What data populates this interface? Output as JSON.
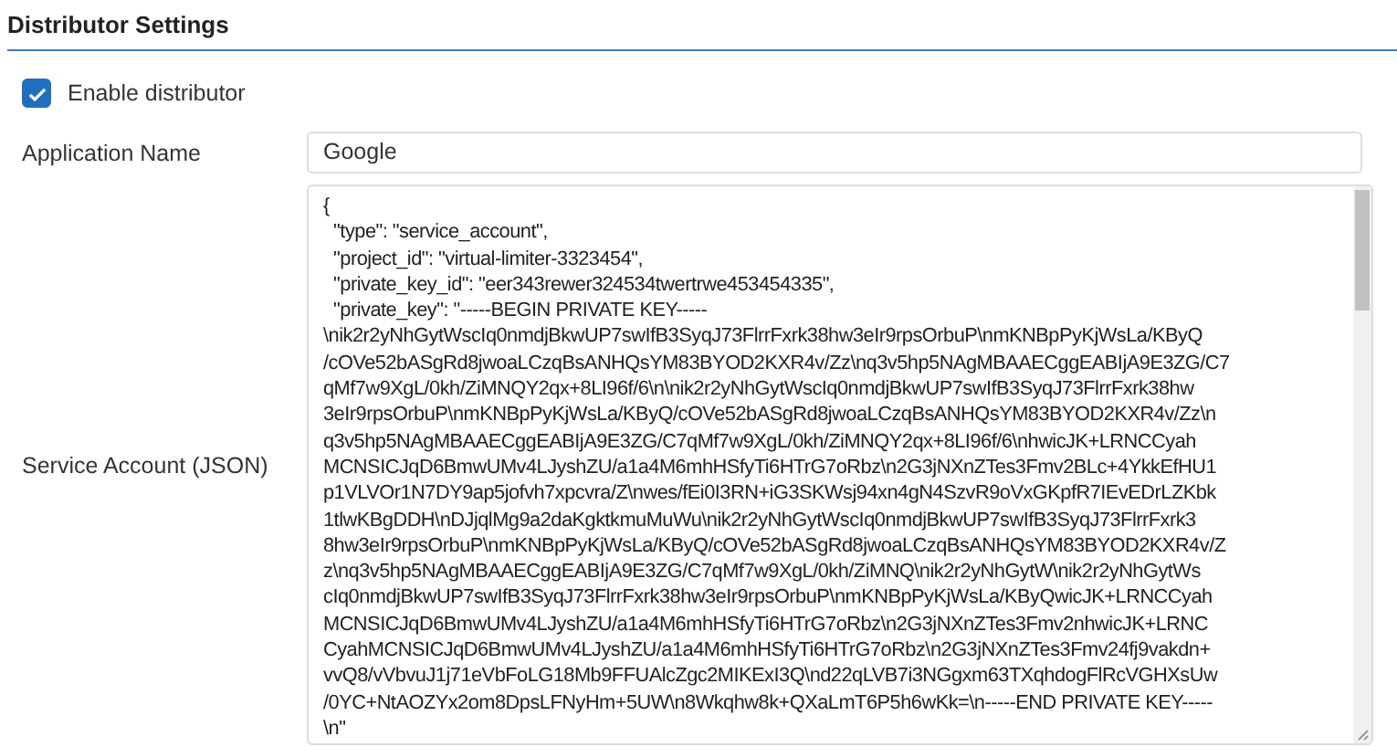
{
  "section": {
    "title": "Distributor Settings"
  },
  "enable_distributor": {
    "label": "Enable distributor",
    "checked": true
  },
  "fields": [
    {
      "kind": "input",
      "label": "Application Name",
      "value": "Google"
    },
    {
      "kind": "textarea",
      "label": "Service Account (JSON)",
      "value_lines": [
        "{",
        "  \"type\": \"service_account\",",
        "  \"project_id\": \"virtual-limiter-3323454\",",
        "  \"private_key_id\": \"eer343rewer324534twertrwe453454335\",",
        "  \"private_key\": \"-----BEGIN PRIVATE KEY-----",
        "\\nik2r2yNhGytWscIq0nmdjBkwUP7swIfB3SyqJ73FlrrFxrk38hw3eIr9rpsOrbuP\\nmKNBpPyKjWsLa/KByQ",
        "/cOVe52bASgRd8jwoaLCzqBsANHQsYM83BYOD2KXR4v/Zz\\nq3v5hp5NAgMBAAECggEABIjA9E3ZG/C7",
        "qMf7w9XgL/0kh/ZiMNQY2qx+8LI96f/6\\n\\nik2r2yNhGytWscIq0nmdjBkwUP7swIfB3SyqJ73FlrrFxrk38hw",
        "3eIr9rpsOrbuP\\nmKNBpPyKjWsLa/KByQ/cOVe52bASgRd8jwoaLCzqBsANHQsYM83BYOD2KXR4v/Zz\\n",
        "q3v5hp5NAgMBAAECggEABIjA9E3ZG/C7qMf7w9XgL/0kh/ZiMNQY2qx+8LI96f/6\\nhwicJK+LRNCCyah",
        "MCNSICJqD6BmwUMv4LJyshZU/a1a4M6mhHSfyTi6HTrG7oRbz\\n2G3jNXnZTes3Fmv2BLc+4YkkEfHU1",
        "p1VLVOr1N7DY9ap5jofvh7xpcvra/Z\\nwes/fEi0I3RN+iG3SKWsj94xn4gN4SzvR9oVxGKpfR7IEvEDrLZKbk",
        "1tlwKBgDDH\\nDJjqlMg9a2daKgktkmuMuWu\\nik2r2yNhGytWscIq0nmdjBkwUP7swIfB3SyqJ73FlrrFxrk3",
        "8hw3eIr9rpsOrbuP\\nmKNBpPyKjWsLa/KByQ/cOVe52bASgRd8jwoaLCzqBsANHQsYM83BYOD2KXR4v/Z",
        "z\\nq3v5hp5NAgMBAAECggEABIjA9E3ZG/C7qMf7w9XgL/0kh/ZiMNQ\\nik2r2yNhGytW\\nik2r2yNhGytWs",
        "cIq0nmdjBkwUP7swIfB3SyqJ73FlrrFxrk38hw3eIr9rpsOrbuP\\nmKNBpPyKjWsLa/KByQwicJK+LRNCCyah",
        "MCNSICJqD6BmwUMv4LJyshZU/a1a4M6mhHSfyTi6HTrG7oRbz\\n2G3jNXnZTes3Fmv2nhwicJK+LRNC",
        "CyahMCNSICJqD6BmwUMv4LJyshZU/a1a4M6mhHSfyTi6HTrG7oRbz\\n2G3jNXnZTes3Fmv24fj9vakdn+",
        "vvQ8/vVbvuJ1j71eVbFoLG18Mb9FFUAlcZgc2MIKExI3Q\\nd22qLVB7i3NGgxm63TXqhdogFlRcVGHXsUw",
        "/0YC+NtAOZYx2om8DpsLFNyHm+5UW\\n8Wkqhw8k+QXaLmT6P5h6wKk=\\n-----END PRIVATE KEY-----",
        "\\n\""
      ]
    }
  ]
}
